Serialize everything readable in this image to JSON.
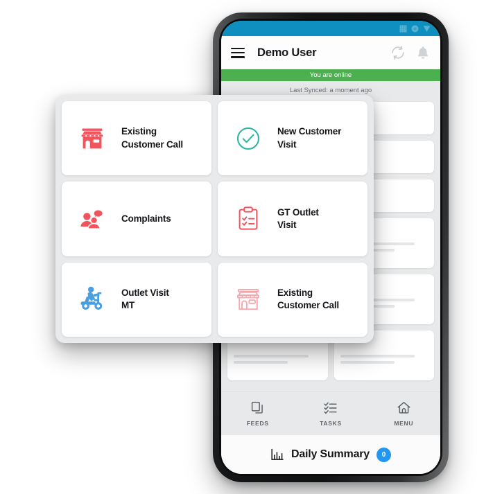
{
  "device": {
    "status_bar": {
      "background_color": "#0e8fc0",
      "icons": [
        "signal-icon",
        "wifi-icon",
        "battery-icon"
      ]
    },
    "header": {
      "menu_icon": "hamburger-menu-icon",
      "title": "Demo User",
      "sync_icon": "sync-icon",
      "notification_icon": "bell-icon",
      "background_color": "#fdfdfd"
    },
    "online_banner": {
      "text": "You are online",
      "color": "#4caf50"
    },
    "sync_status": {
      "text": "Last Synced: a moment ago"
    },
    "bottom_tabs": [
      {
        "label": "FEEDS",
        "icon": "copy-icon"
      },
      {
        "label": "TASKS",
        "icon": "checklist-icon"
      },
      {
        "label": "MENU",
        "icon": "home-icon"
      }
    ],
    "daily_summary": {
      "icon": "bar-chart-icon",
      "title": "Daily Summary",
      "badge_count": "0",
      "badge_color": "#2196f3"
    },
    "feed_placeholder_columns": [
      {
        "cards": [
          1,
          2,
          3,
          4,
          5
        ]
      },
      {
        "cards": [
          1,
          2,
          3,
          4,
          5
        ]
      }
    ]
  },
  "action_panel": {
    "background_color": "#e8eaec",
    "cards": [
      {
        "label": "Existing\nCustomer Call",
        "icon": "store-filled-icon",
        "icon_color": "#f0555e"
      },
      {
        "label": "New Customer\nVisit",
        "icon": "check-circle-icon",
        "icon_color": "#2bb8a3"
      },
      {
        "label": "Complaints",
        "icon": "people-group-icon",
        "icon_color": "#f0555e"
      },
      {
        "label": "GT Outlet\nVisit",
        "icon": "clipboard-check-icon",
        "icon_color": "#f0555e"
      },
      {
        "label": "Outlet Visit\nMT",
        "icon": "scooter-rider-icon",
        "icon_color": "#4a9fe0"
      },
      {
        "label": "Existing\nCustomer Call",
        "icon": "store-outline-icon",
        "icon_color": "#f5a8ae"
      }
    ]
  }
}
